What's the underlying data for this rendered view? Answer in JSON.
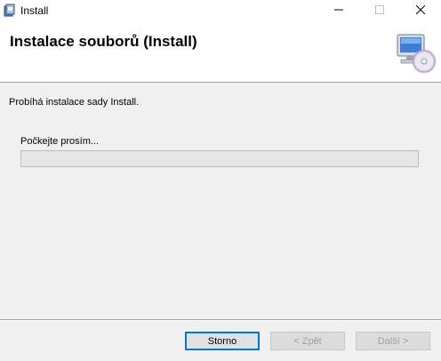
{
  "window": {
    "title": "Install",
    "minimize_icon": "minimize-icon",
    "maximize_icon": "maximize-icon",
    "close_icon": "close-icon"
  },
  "header": {
    "title": "Instalace souborů (Install)",
    "icon": "computer-cd-icon"
  },
  "main": {
    "status": "Probíhá instalace sady Install.",
    "wait_label": "Počkejte prosím...",
    "progress": 0
  },
  "buttons": {
    "cancel": "Storno",
    "back": "< Zpět",
    "next": "Další >"
  }
}
